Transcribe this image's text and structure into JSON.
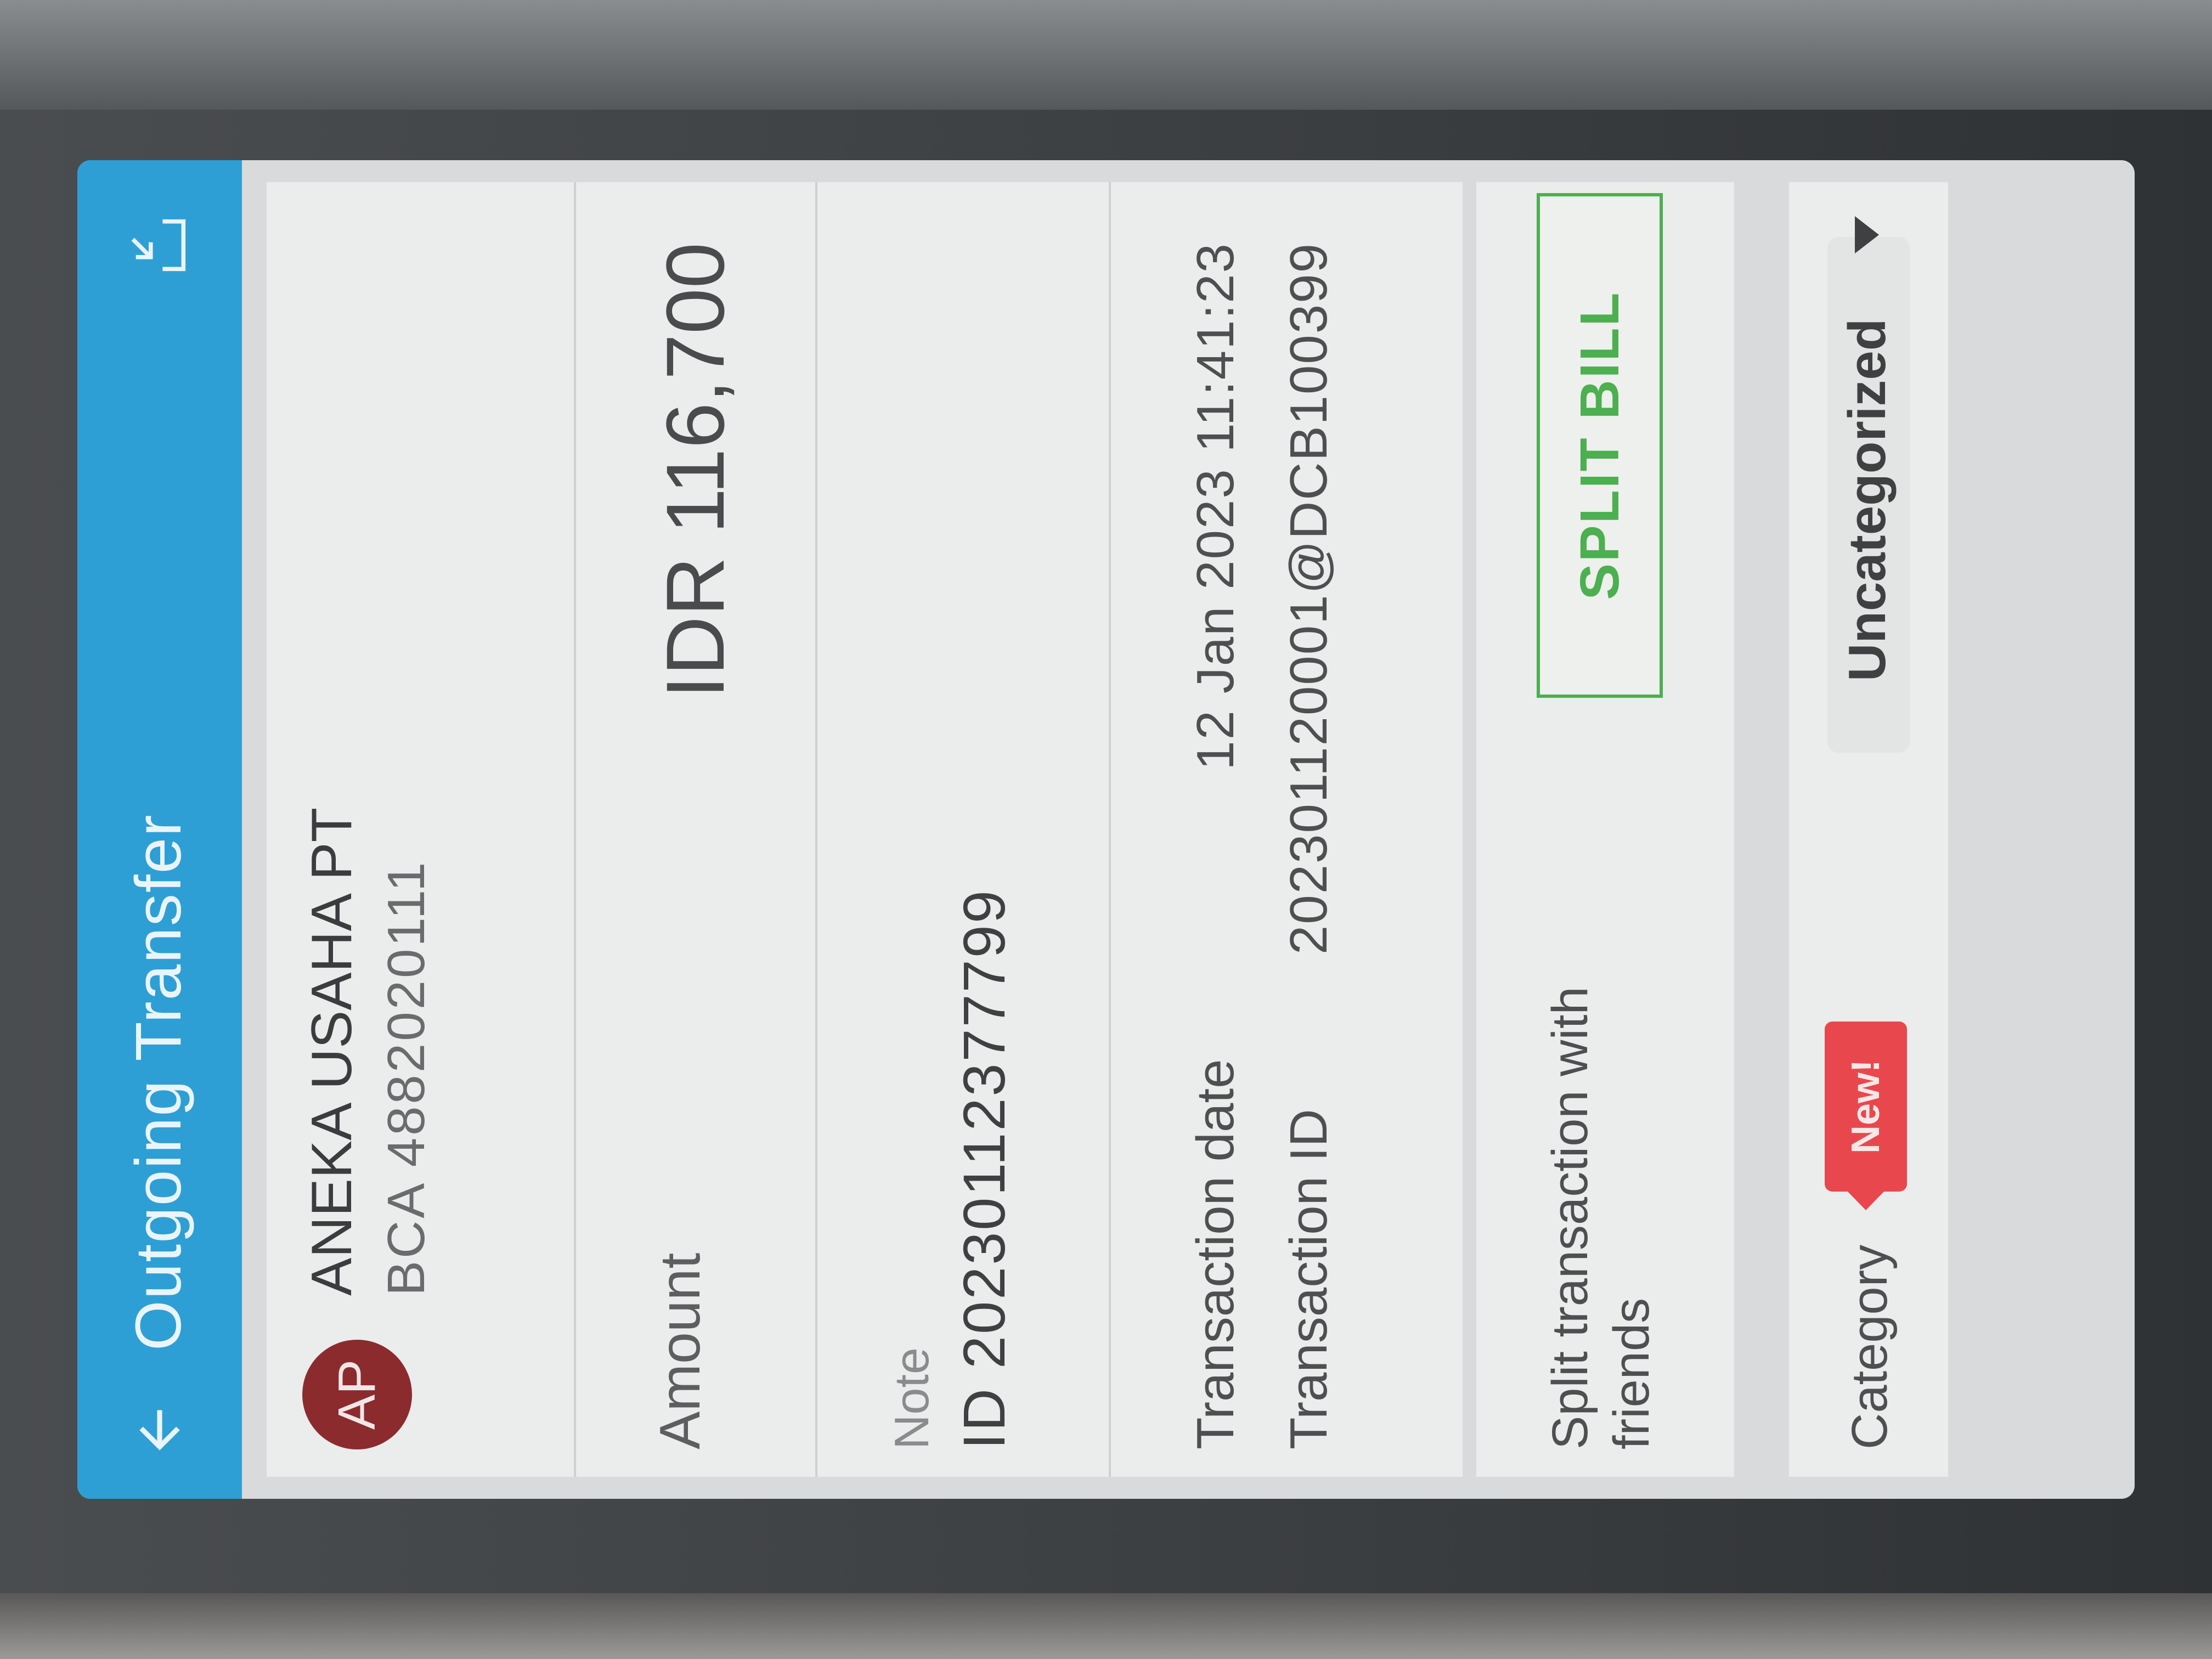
{
  "appbar": {
    "title": "Outgoing Transfer",
    "back_icon": "arrow-left-icon",
    "export_icon": "download-export-icon",
    "color": "#2e9fd4"
  },
  "merchant": {
    "initials": "AP",
    "name": "ANEKA USAHA PT",
    "account": "BCA 4882020111",
    "avatar_color": "#8b2b2e"
  },
  "amount": {
    "label": "Amount",
    "value": "IDR 116,700"
  },
  "note": {
    "label": "Note",
    "value": "ID 20230112377799"
  },
  "details": {
    "date_label": "Transaction date",
    "date_value": "12 Jan 2023 11:41:23",
    "id_label": "Transaction ID",
    "id_value": "202301120001@DCB100399"
  },
  "split": {
    "text": "Split transaction with friends",
    "button_label": "SPLIT BILL",
    "button_color": "#4caf50"
  },
  "category": {
    "label": "Category",
    "badge": "New!",
    "badge_color": "#e8484d",
    "value": "Uncategorized"
  }
}
